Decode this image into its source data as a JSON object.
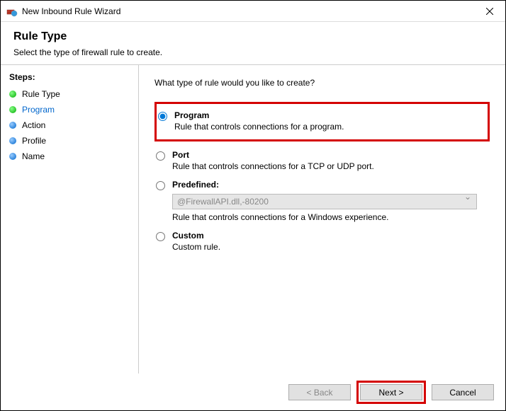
{
  "window": {
    "title": "New Inbound Rule Wizard"
  },
  "header": {
    "title": "Rule Type",
    "subtitle": "Select the type of firewall rule to create."
  },
  "sidebar": {
    "label": "Steps:",
    "items": [
      {
        "label": "Rule Type",
        "bullet": "green",
        "current": false
      },
      {
        "label": "Program",
        "bullet": "green",
        "current": true
      },
      {
        "label": "Action",
        "bullet": "blue",
        "current": false
      },
      {
        "label": "Profile",
        "bullet": "blue",
        "current": false
      },
      {
        "label": "Name",
        "bullet": "blue",
        "current": false
      }
    ]
  },
  "main": {
    "question": "What type of rule would you like to create?",
    "options": {
      "program": {
        "name": "Program",
        "desc": "Rule that controls connections for a program."
      },
      "port": {
        "name": "Port",
        "desc": "Rule that controls connections for a TCP or UDP port."
      },
      "predefined": {
        "name": "Predefined:",
        "select_value": "@FirewallAPI.dll,-80200",
        "desc": "Rule that controls connections for a Windows experience."
      },
      "custom": {
        "name": "Custom",
        "desc": "Custom rule."
      }
    }
  },
  "footer": {
    "back": "< Back",
    "next": "Next >",
    "cancel": "Cancel"
  }
}
